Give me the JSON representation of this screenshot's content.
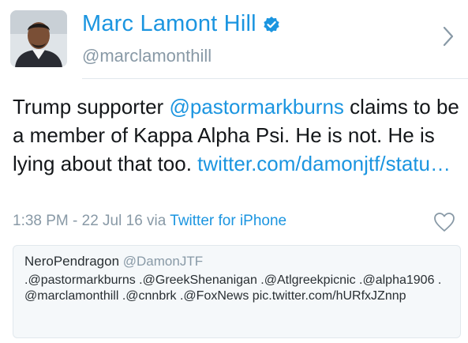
{
  "author": {
    "display_name": "Marc Lamont Hill",
    "handle": "@marclamonthill",
    "avatar_icon": "profile-photo",
    "verified_icon": "verified-badge-icon"
  },
  "tweet": {
    "text_before": "Trump supporter ",
    "mention": "@pastormarkburns",
    "text_after": " claims to be a member of Kappa Alpha Psi. He is not. He is lying about that too.  ",
    "link": "twitter.com/damonjtf/statu…"
  },
  "meta": {
    "timestamp": "1:38 PM - 22 Jul 16 via ",
    "source": "Twitter for iPhone"
  },
  "quoted_tweet": {
    "name": "NeroPendragon",
    "handle": "@DamonJTF",
    "text": ".@pastormarkburns .@GreekShenanigan .@Atlgreekpicnic .@alpha1906 .@marclamonthill .@cnnbrk .@FoxNews pic.twitter.com/hURfxJZnnp"
  },
  "colors": {
    "accent": "#1b95e0",
    "muted": "#8899a6",
    "text": "#14171a"
  }
}
